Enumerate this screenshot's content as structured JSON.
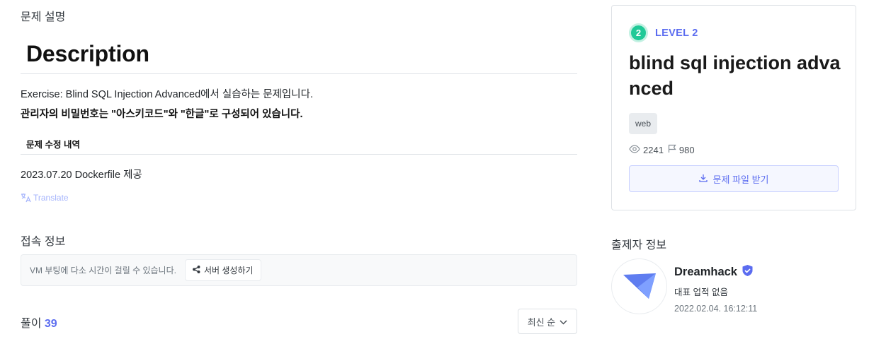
{
  "problem": {
    "section_title": "문제 설명",
    "heading": "Description",
    "line1": "Exercise: Blind SQL Injection Advanced에서 실습하는 문제입니다.",
    "line2": "관리자의 비밀번호는 \"아스키코드\"와 \"한글\"로 구성되어 있습니다.",
    "edit_heading": "문제 수정 내역",
    "edit_line": "2023.07.20 Dockerfile 제공",
    "translate_label": "Translate",
    "translate_icon": "translate-icon"
  },
  "connection": {
    "section_title": "접속 정보",
    "message": "VM 부팅에 다소 시간이 걸릴 수 있습니다.",
    "button_label": "서버 생성하기",
    "button_icon": "share-icon"
  },
  "solutions": {
    "label": "풀이",
    "count": "39",
    "sort_label": "최신 순",
    "sort_icon": "chevron-down-icon"
  },
  "card": {
    "level_number": "2",
    "level_label": "LEVEL 2",
    "level_color": "#20c997",
    "accent_color": "#5b6cf0",
    "title": "blind sql injection advanced",
    "tag": "web",
    "views": "2241",
    "solves": "980",
    "download_label": "문제 파일 받기",
    "download_icon": "download-icon"
  },
  "author": {
    "section_title": "출제자 정보",
    "name": "Dreamhack",
    "description": "대표 업적 없음",
    "date": "2022.02.04. 16:12:11",
    "verified_icon": "verified-badge-icon"
  }
}
